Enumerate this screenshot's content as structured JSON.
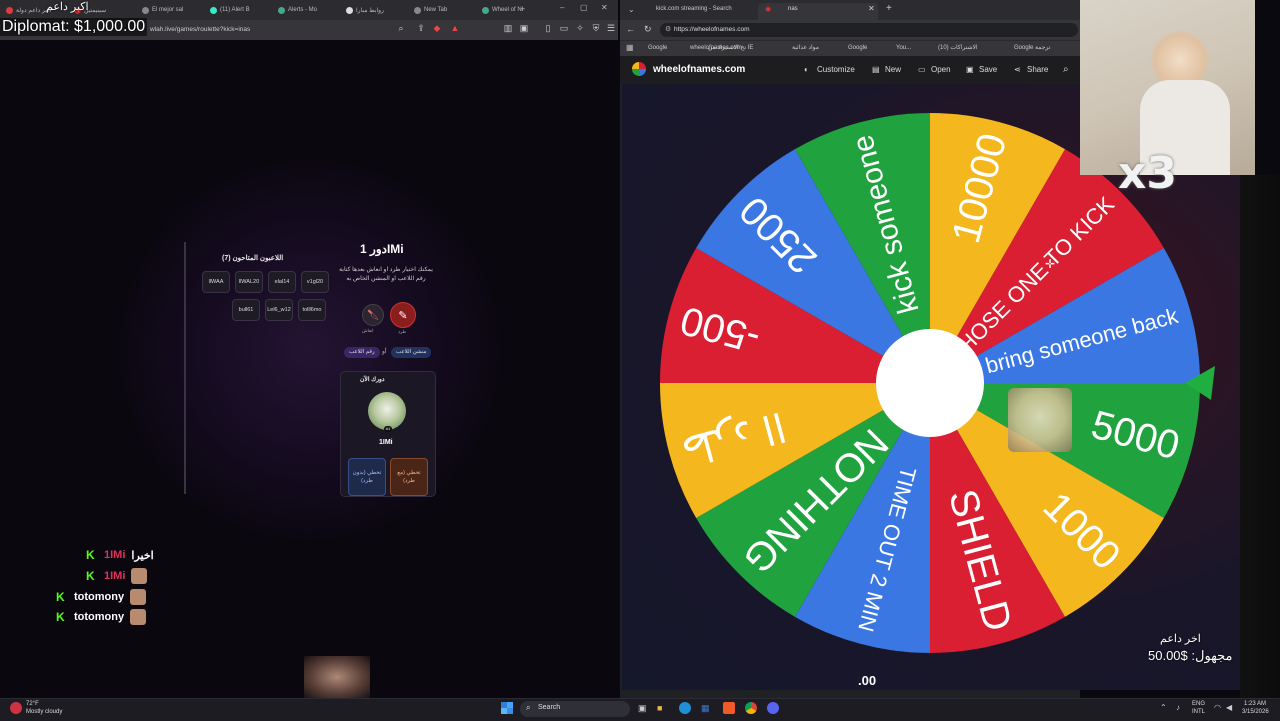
{
  "left_browser": {
    "tabs": [
      {
        "label": "اكبر داعم دولة",
        "color": "#e23a3a"
      },
      {
        "label": "سينيمتين",
        "color": "#c22"
      },
      {
        "label": "El mejor sal",
        "color": "#888"
      },
      {
        "label": "(11) Alert B",
        "color": "#3ec"
      },
      {
        "label": "Alerts - Mo",
        "color": "#4a8"
      },
      {
        "label": "روابط مبارا",
        "color": "#ddd"
      },
      {
        "label": "New Tab",
        "color": "#888"
      },
      {
        "label": "Wheel of N",
        "color": "#4a8"
      }
    ],
    "url": "wlah.live/games/roulette?kick=inas",
    "overlay_top": "اكبر داعم",
    "diplomat": "Diplomat: $1,000.00"
  },
  "game": {
    "turn_title": "دور 1IMi",
    "players_title": "اللاعبون المتاحون (7)",
    "players_row1": [
      "llWAA",
      "llWAL20",
      "elal14",
      "v1gl20"
    ],
    "players_row2": [
      "bull61",
      "Lel6_w12",
      "tolll6mo"
    ],
    "description": "يمكنك اختيار طرد او انعاش بعدها كتابة رقم اللاعب او المنشن الخاص به",
    "action_revive": "انعاش",
    "action_kick": "طرد",
    "pill_number": "رقم اللاعب",
    "pill_or": "أو",
    "pill_mention": "منشن اللاعب",
    "current_turn_label": "دورك الآن",
    "current_player": "1IMi",
    "avatar_badge": "#1",
    "btn_skip_no_kick": "تخطي (بدون طرد)",
    "btn_skip_with_kick": "تخطي (مع طرد)"
  },
  "chat": [
    {
      "user": "1IMi",
      "message": "اخيرا",
      "user_color": "#e0335a",
      "has_avatar": false
    },
    {
      "user": "1IMi",
      "message": "",
      "user_color": "#e0335a",
      "has_avatar": true
    },
    {
      "user": "totomony",
      "message": "",
      "user_color": "#ffffff",
      "has_avatar": true
    },
    {
      "user": "totomony",
      "message": "",
      "user_color": "#ffffff",
      "has_avatar": true
    }
  ],
  "right_browser": {
    "tabs": [
      "kick.com streaming - Search",
      "nas"
    ],
    "url": "https://wheelofnames.com",
    "bookmarks": [
      "Google",
      "wheelofnames.com",
      "تخ الاستيراد من IE",
      "مواد غذائية",
      "Google",
      "You...",
      "(10) الاشتراكات",
      "Google ترجمة"
    ],
    "site_name": "wheelofnames.com",
    "toolbar": [
      "Customize",
      "New",
      "Open",
      "Save",
      "Share"
    ]
  },
  "wheel": {
    "segments": [
      {
        "label": "CHOSE ONE TO KICK",
        "color": "#db1f32"
      },
      {
        "label": "bring someone back",
        "color": "#3a77e3"
      },
      {
        "label": "5000",
        "color": "#20a23f"
      },
      {
        "label": "1000",
        "color": "#f4b81e"
      },
      {
        "label": "SHIELD",
        "color": "#db1f32"
      },
      {
        "label": "TIME OUT 2 MIN",
        "color": "#3a77e3"
      },
      {
        "label": "NOTHING",
        "color": "#20a23f"
      },
      {
        "label": "طرد اا",
        "color": "#f4b81e"
      },
      {
        "label": "-500",
        "color": "#db1f32"
      },
      {
        "label": "2500",
        "color": "#3a77e3"
      },
      {
        "label": "kick someone",
        "color": "#20a23f"
      },
      {
        "label": "10000",
        "color": "#f4b81e"
      }
    ]
  },
  "donation": {
    "title": "اخر داعم",
    "text": "مجهول: $50.00",
    "bottom_amount": ".00"
  },
  "overlay": {
    "multiplier": "x3"
  },
  "taskbar": {
    "weather_temp": "72°F",
    "weather_desc": "Mostly cloudy",
    "search_label": "Search",
    "lang_1": "ENG",
    "lang_2": "INTL",
    "time": "1:23 AM",
    "date": "3/15/2026"
  }
}
